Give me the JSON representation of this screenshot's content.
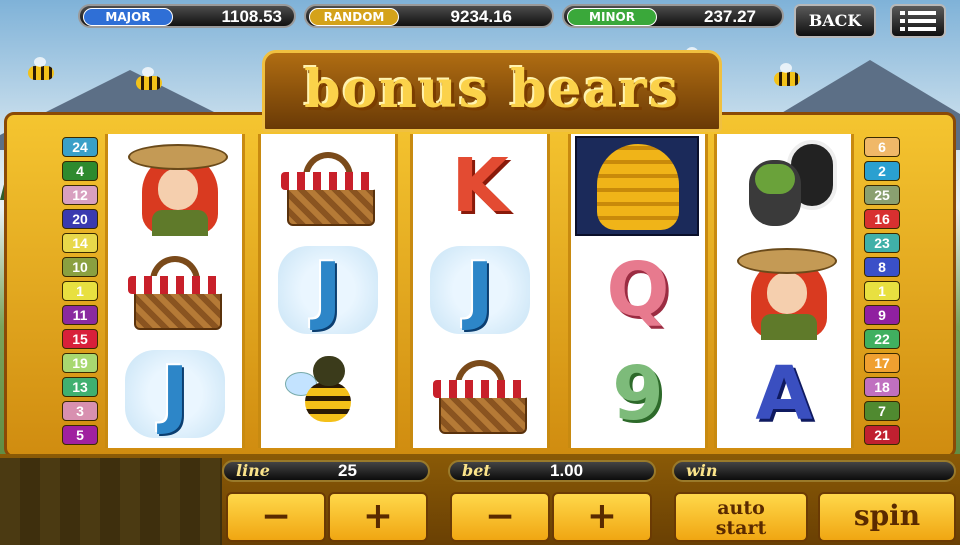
{
  "jackpots": [
    {
      "label": "MAJOR",
      "value": "1108.53",
      "color": "#2f6fd6"
    },
    {
      "label": "RANDOM",
      "value": "9234.16",
      "color": "#d4a21a"
    },
    {
      "label": "MINOR",
      "value": "237.27",
      "color": "#3aa83a"
    }
  ],
  "top_buttons": {
    "back_label": "BACK",
    "menu_icon": "menu-icon"
  },
  "title": "bonus bears",
  "paylines_left": [
    "24",
    "4",
    "12",
    "20",
    "14",
    "10",
    "1",
    "11",
    "15",
    "19",
    "13",
    "3",
    "5"
  ],
  "paylines_right": [
    "6",
    "2",
    "25",
    "16",
    "23",
    "8",
    "1",
    "9",
    "22",
    "17",
    "18",
    "7",
    "21"
  ],
  "payline_colors_left": [
    "#3aa0c8",
    "#2e8a2e",
    "#d8a0c0",
    "#3a3ab0",
    "#e8d84a",
    "#8aa040",
    "#e8e040",
    "#8a2aa0",
    "#d8203a",
    "#a8d870",
    "#40b070",
    "#d890b0",
    "#a020a0"
  ],
  "payline_colors_right": [
    "#f0b868",
    "#2aa0d0",
    "#8aa070",
    "#d83030",
    "#40b0a8",
    "#3a50c8",
    "#e8e040",
    "#9020a0",
    "#40b060",
    "#f0a030",
    "#c070c0",
    "#508a30",
    "#c02030"
  ],
  "reels": [
    [
      "ranger",
      "basket",
      "J"
    ],
    [
      "basket",
      "J",
      "bee"
    ],
    [
      "K",
      "J",
      "basket"
    ],
    [
      "beehive",
      "Q",
      "9"
    ],
    [
      "skunk",
      "ranger",
      "A"
    ]
  ],
  "bottom": {
    "line_label": "line",
    "line_value": "25",
    "bet_label": "bet",
    "bet_value": "1.00",
    "win_label": "win",
    "win_value": "",
    "minus": "−",
    "plus": "+",
    "auto_start_label": "auto start",
    "spin_label": "spin"
  }
}
